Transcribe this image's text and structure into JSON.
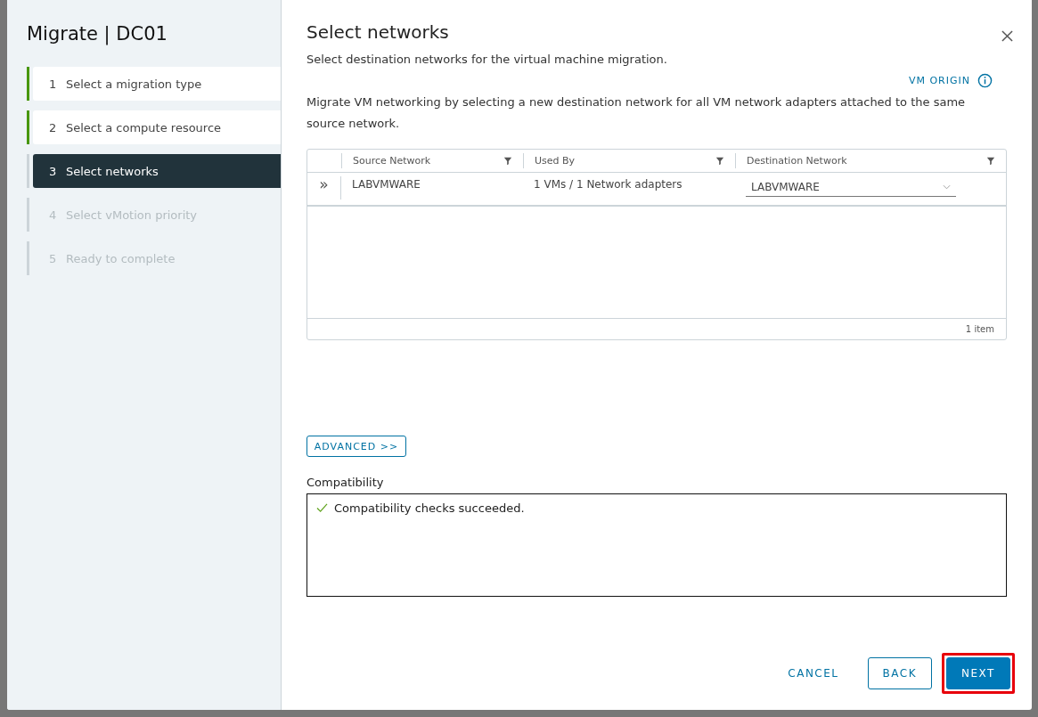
{
  "dialog": {
    "title": "Migrate | DC01",
    "steps": [
      {
        "number": "1",
        "label": "Select a migration type",
        "kind": "complete",
        "selected": false
      },
      {
        "number": "2",
        "label": "Select a compute resource",
        "kind": "complete",
        "selected": false
      },
      {
        "number": "3",
        "label": "Select networks",
        "kind": "incomplete",
        "selected": true
      },
      {
        "number": "4",
        "label": "Select vMotion priority",
        "kind": "incomplete",
        "selected": false
      },
      {
        "number": "5",
        "label": "Ready to complete",
        "kind": "incomplete",
        "selected": false
      }
    ],
    "page_title": "Select networks",
    "subtitle": "Select destination networks for the virtual machine migration.",
    "vm_origin_link": "VM ORIGIN",
    "description": "Migrate VM networking by selecting a new destination network for all VM network adapters attached to the same source network.",
    "table": {
      "columns": [
        "Source Network",
        "Used By",
        "Destination Network"
      ],
      "rows": [
        {
          "expand": "»",
          "source": "LABVMWARE",
          "used_by": "1 VMs / 1 Network adapters",
          "destination": "LABVMWARE"
        }
      ],
      "footer": "1 item"
    },
    "advanced_button": "ADVANCED >>",
    "compatibility_label": "Compatibility",
    "compatibility_message": "Compatibility checks succeeded.",
    "buttons": [
      {
        "label": "CANCEL",
        "kind": "flat",
        "highlighted": false
      },
      {
        "label": "BACK",
        "kind": "outline",
        "highlighted": false
      },
      {
        "label": "NEXT",
        "kind": "primary",
        "highlighted": true
      }
    ]
  }
}
